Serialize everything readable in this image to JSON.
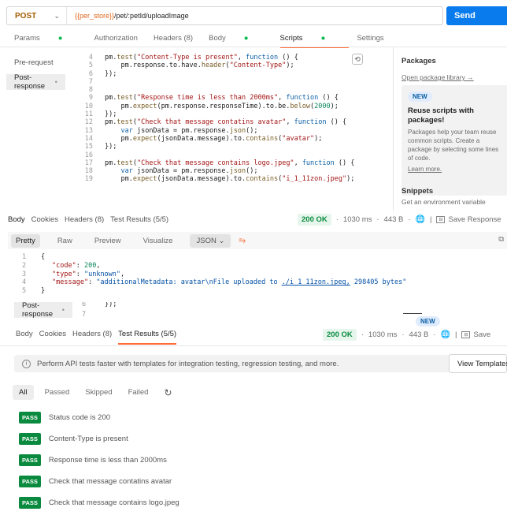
{
  "request": {
    "method": "POST",
    "url_var": "{{per_store}}",
    "url_path": "/pet/:petId/uploadImage",
    "send_label": "Send"
  },
  "req_tabs": {
    "params": "Params",
    "authorization": "Authorization",
    "headers": "Headers (8)",
    "body": "Body",
    "scripts": "Scripts",
    "settings": "Settings"
  },
  "script_sidebar": {
    "pre": "Pre-request",
    "post": "Post-response"
  },
  "code_lines": [
    {
      "n": "4",
      "text": "pm.test(\"Content-Type is present\", function () {"
    },
    {
      "n": "5",
      "text": "    pm.response.to.have.header(\"Content-Type\");"
    },
    {
      "n": "6",
      "text": "});"
    },
    {
      "n": "7",
      "text": ""
    },
    {
      "n": "8",
      "text": ""
    },
    {
      "n": "9",
      "text": "pm.test(\"Response time is less than 2000ms\", function () {"
    },
    {
      "n": "10",
      "text": "    pm.expect(pm.response.responseTime).to.be.below(2000);"
    },
    {
      "n": "11",
      "text": "});"
    },
    {
      "n": "12",
      "text": "pm.test(\"Check that message contatins avatar\", function () {"
    },
    {
      "n": "13",
      "text": "    var jsonData = pm.response.json();"
    },
    {
      "n": "14",
      "text": "    pm.expect(jsonData.message).to.contains(\"avatar\");"
    },
    {
      "n": "15",
      "text": "});"
    },
    {
      "n": "16",
      "text": ""
    },
    {
      "n": "17",
      "text": "pm.test(\"Check that message contains logo.jpeg\", function () {"
    },
    {
      "n": "18",
      "text": "    var jsonData = pm.response.json();"
    },
    {
      "n": "19",
      "text": "    pm.expect(jsonData.message).to.contains(\"i_1_11zon.jpeg\");"
    }
  ],
  "packages": {
    "title": "Packages",
    "open_library": "Open package library →",
    "badge": "NEW",
    "promo_title": "Reuse scripts with packages!",
    "promo_desc": "Packages help your team reuse common scripts. Create a package by selecting some lines of code.",
    "learn_more": "Learn more.",
    "snippets": "Snippets",
    "snippet_first": "Get an environment variable"
  },
  "response": {
    "tabs": {
      "body": "Body",
      "cookies": "Cookies",
      "headers": "Headers (8)",
      "tests": "Test Results (5/5)"
    },
    "status": "200 OK",
    "time": "1030 ms",
    "size": "443 B",
    "save": "Save Response",
    "save_short": "Save",
    "formats": {
      "pretty": "Pretty",
      "raw": "Raw",
      "preview": "Preview",
      "visualize": "Visualize",
      "json": "JSON"
    },
    "json_lines": [
      {
        "n": "1",
        "text": "{"
      },
      {
        "n": "2",
        "key": "\"code\"",
        "val": "200",
        "type": "num"
      },
      {
        "n": "3",
        "key": "\"type\"",
        "val": "\"unknown\"",
        "type": "str"
      },
      {
        "n": "4",
        "key": "\"message\"",
        "val_pre": "\"additionalMetadata: avatar\\nFile uploaded to ",
        "val_link": "./i_1_11zon.jpeg,",
        "val_post": " 298405 bytes\"",
        "type": "msg"
      },
      {
        "n": "5",
        "text": "}"
      }
    ]
  },
  "overlap": {
    "post": "Post-response",
    "line6": "6",
    "line6_text": "});",
    "line7": "7",
    "badge": "NEW"
  },
  "tests": {
    "banner": "Perform API tests faster with templates for integration testing, regression testing, and more.",
    "view_templates": "View Templates",
    "filters": {
      "all": "All",
      "passed": "Passed",
      "skipped": "Skipped",
      "failed": "Failed"
    },
    "pass_label": "PASS",
    "results": [
      "Status code is 200",
      "Content-Type is present",
      "Response time is less than 2000ms",
      "Check that message contatins avatar",
      "Check that message contains logo.jpeg"
    ]
  }
}
